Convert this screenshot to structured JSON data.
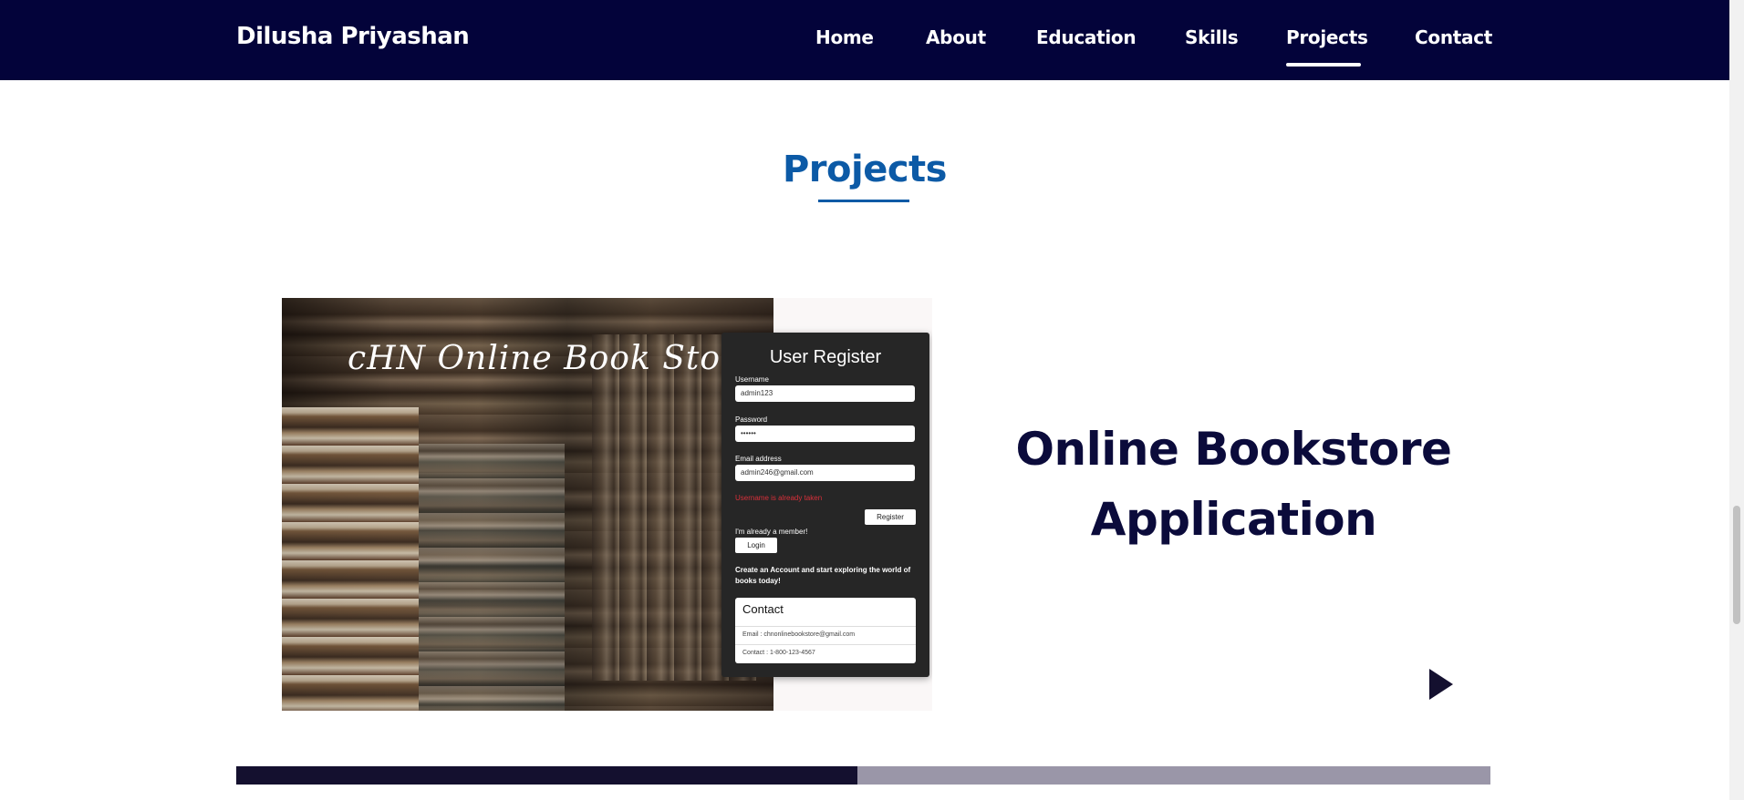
{
  "navbar": {
    "brand": "Dilusha Priyashan",
    "items": [
      {
        "label": "Home"
      },
      {
        "label": "About"
      },
      {
        "label": "Education"
      },
      {
        "label": "Skills"
      },
      {
        "label": "Projects"
      },
      {
        "label": "Contact"
      }
    ],
    "active": "Projects",
    "background": "#03033a"
  },
  "section": {
    "title": "Projects",
    "accent": "#0c5aa6"
  },
  "project": {
    "title_line1": "Online Bookstore",
    "title_line2": "Application",
    "image": {
      "caption": "cHN Online Book Store",
      "register": {
        "title": "User Register",
        "username_label": "Username",
        "username_value": "admin123",
        "password_label": "Password",
        "password_value": "••••••",
        "email_label": "Email address",
        "email_value": "admin246@gmail.com",
        "error": "Username is already taken",
        "register_button": "Register",
        "member_text": "I'm already a member!",
        "login_button": "Login",
        "cta": "Create an Account and start exploring the world of books today!",
        "contact_title": "Contact",
        "contact_email": "Email : chnonlinebookstore@gmail.com",
        "contact_phone": "Contact : 1-800-123-4567"
      }
    },
    "next_icon": "play-triangle-icon"
  },
  "carousel": {
    "progress_fraction": 0.495,
    "fill_color": "#14102f",
    "track_color": "#9a96a8"
  }
}
